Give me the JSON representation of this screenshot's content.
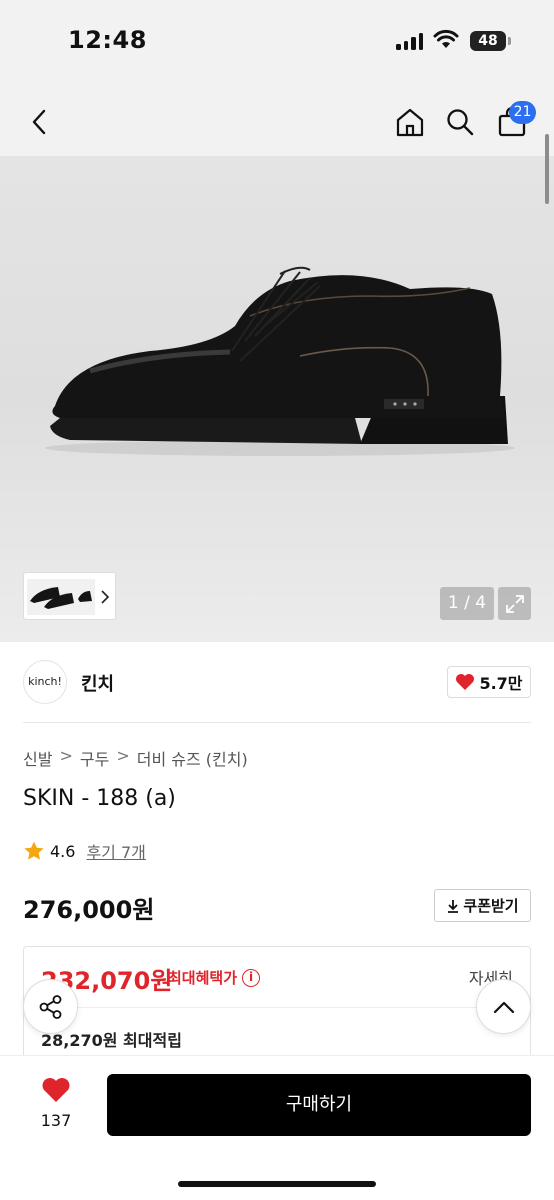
{
  "status": {
    "time": "12:48",
    "battery": "48"
  },
  "nav": {
    "cart_count": "21"
  },
  "gallery": {
    "counter": "1 / 4"
  },
  "brand": {
    "logo_text": "kinch!",
    "name": "킨치",
    "likes": "5.7만"
  },
  "breadcrumb": {
    "items": [
      "신발",
      "구두",
      "더비 슈즈 (킨치)"
    ],
    "separator": ">"
  },
  "product": {
    "title": "SKIN - 188 (a)",
    "rating": "4.6",
    "review_link": "후기 7개",
    "price": "276,000원",
    "coupon_label": "쿠폰받기"
  },
  "benefit": {
    "max_price": "232,070원",
    "max_label": "최대혜택가",
    "detail_label": "자세히",
    "points": "28,270원 최대적립"
  },
  "bottom": {
    "wish_count": "137",
    "buy_label": "구매하기"
  },
  "colors": {
    "accent_red": "#e0242b",
    "badge_blue": "#2b6ef0",
    "buy_black": "#000000"
  }
}
